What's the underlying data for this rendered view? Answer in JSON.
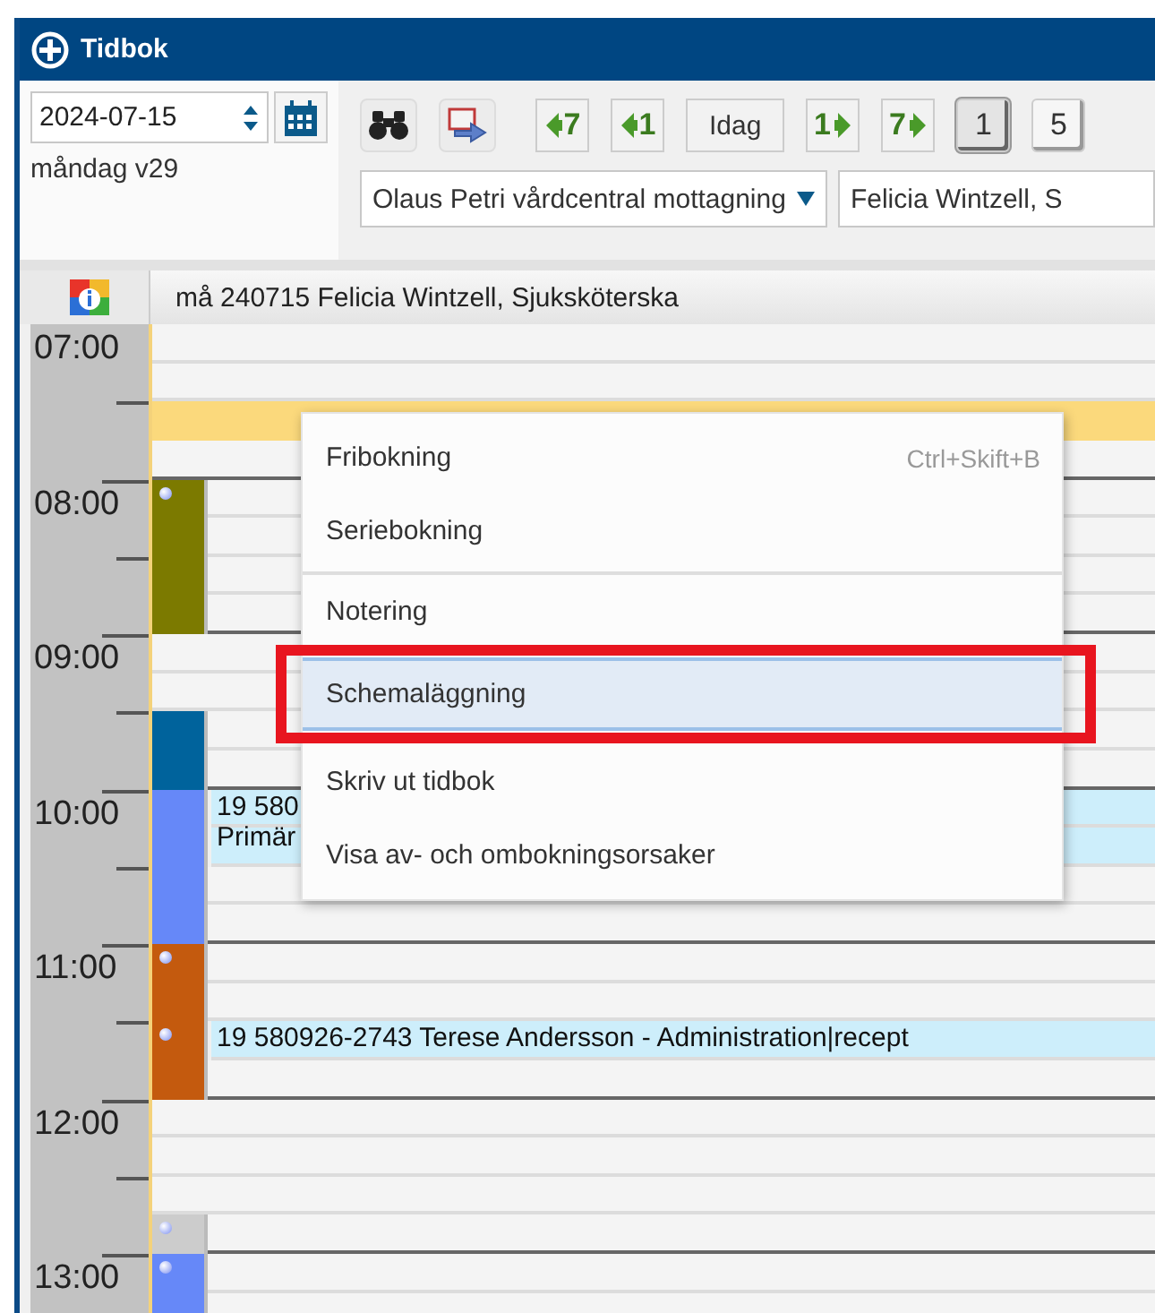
{
  "window": {
    "title": "Tidbok"
  },
  "toolbar": {
    "date": "2024-07-15",
    "weekday": "måndag v29",
    "buttons": [
      {
        "kind": "search"
      },
      {
        "kind": "export"
      },
      {
        "kind": "back",
        "label": "7"
      },
      {
        "kind": "back",
        "label": "1"
      },
      {
        "kind": "text",
        "label": "Idag"
      },
      {
        "kind": "forward",
        "label": "1"
      },
      {
        "kind": "forward",
        "label": "7"
      },
      {
        "kind": "view",
        "label": "1",
        "selected": true
      },
      {
        "kind": "view",
        "label": "5",
        "selected": false
      }
    ],
    "unit": "Olaus Petri vårdcentral mottagning",
    "staff": "Felicia Wintzell, S"
  },
  "day_header": "må 240715 Felicia Wintzell, Sjuksköterska",
  "hours": [
    {
      "label": "07:00",
      "slots": [
        {
          "kind": "free"
        },
        {
          "kind": "free"
        },
        {
          "kind": "band",
          "color": "#fbd97c"
        },
        {
          "kind": "free"
        }
      ]
    },
    {
      "label": "08:00",
      "slots": [
        {
          "kind": "block",
          "color": "#7c7a00",
          "marker": true
        },
        {
          "kind": "block",
          "color": "#7c7a00",
          "marker": false
        },
        {
          "kind": "block",
          "color": "#7c7a00",
          "marker": false
        },
        {
          "kind": "block",
          "color": "#7c7a00",
          "marker": false
        }
      ]
    },
    {
      "label": "09:00",
      "slots": [
        {
          "kind": "free"
        },
        {
          "kind": "free"
        },
        {
          "kind": "block",
          "color": "#00639c",
          "marker": false
        },
        {
          "kind": "block",
          "color": "#00639c",
          "marker": false
        }
      ]
    },
    {
      "label": "10:00",
      "slots": [
        {
          "kind": "booking",
          "color": "#6688f8",
          "marker": false,
          "lines": [
            "19 580",
            "Primär"
          ]
        },
        {
          "kind": "booking",
          "color": "#6688f8",
          "marker": false
        },
        {
          "kind": "block",
          "color": "#6688f8",
          "marker": false
        },
        {
          "kind": "block",
          "color": "#6688f8",
          "marker": false
        }
      ]
    },
    {
      "label": "11:00",
      "slots": [
        {
          "kind": "block",
          "color": "#c45a0e",
          "marker": true
        },
        {
          "kind": "block",
          "color": "#c45a0e",
          "marker": false
        },
        {
          "kind": "booking",
          "color": "#c45a0e",
          "marker": true,
          "lines": [
            "19 580926-2743  Terese Andersson - Administration|recept"
          ]
        },
        {
          "kind": "block",
          "color": "#c45a0e",
          "marker": false
        }
      ]
    },
    {
      "label": "12:00",
      "slots": [
        {
          "kind": "free"
        },
        {
          "kind": "free"
        },
        {
          "kind": "free"
        },
        {
          "kind": "block",
          "color": "#cccccc",
          "marker": true
        }
      ]
    },
    {
      "label": "13:00",
      "slots": [
        {
          "kind": "block",
          "color": "#6688f8",
          "marker": true
        },
        {
          "kind": "block",
          "color": "#6688f8",
          "marker": false
        }
      ]
    }
  ],
  "context_menu": {
    "groups": [
      [
        {
          "label": "Fribokning",
          "shortcut": "Ctrl+Skift+B",
          "selected": false,
          "callout": false
        },
        {
          "label": "Seriebokning",
          "selected": false,
          "callout": false
        }
      ],
      [
        {
          "label": "Notering",
          "selected": false,
          "callout": false
        },
        {
          "label": "Schemaläggning",
          "selected": true,
          "callout": true
        },
        {
          "label": "Skriv ut tidbok",
          "selected": false,
          "callout": false
        },
        {
          "label": "Visa av- och ombokningsorsaker",
          "selected": false,
          "callout": false
        }
      ]
    ]
  }
}
